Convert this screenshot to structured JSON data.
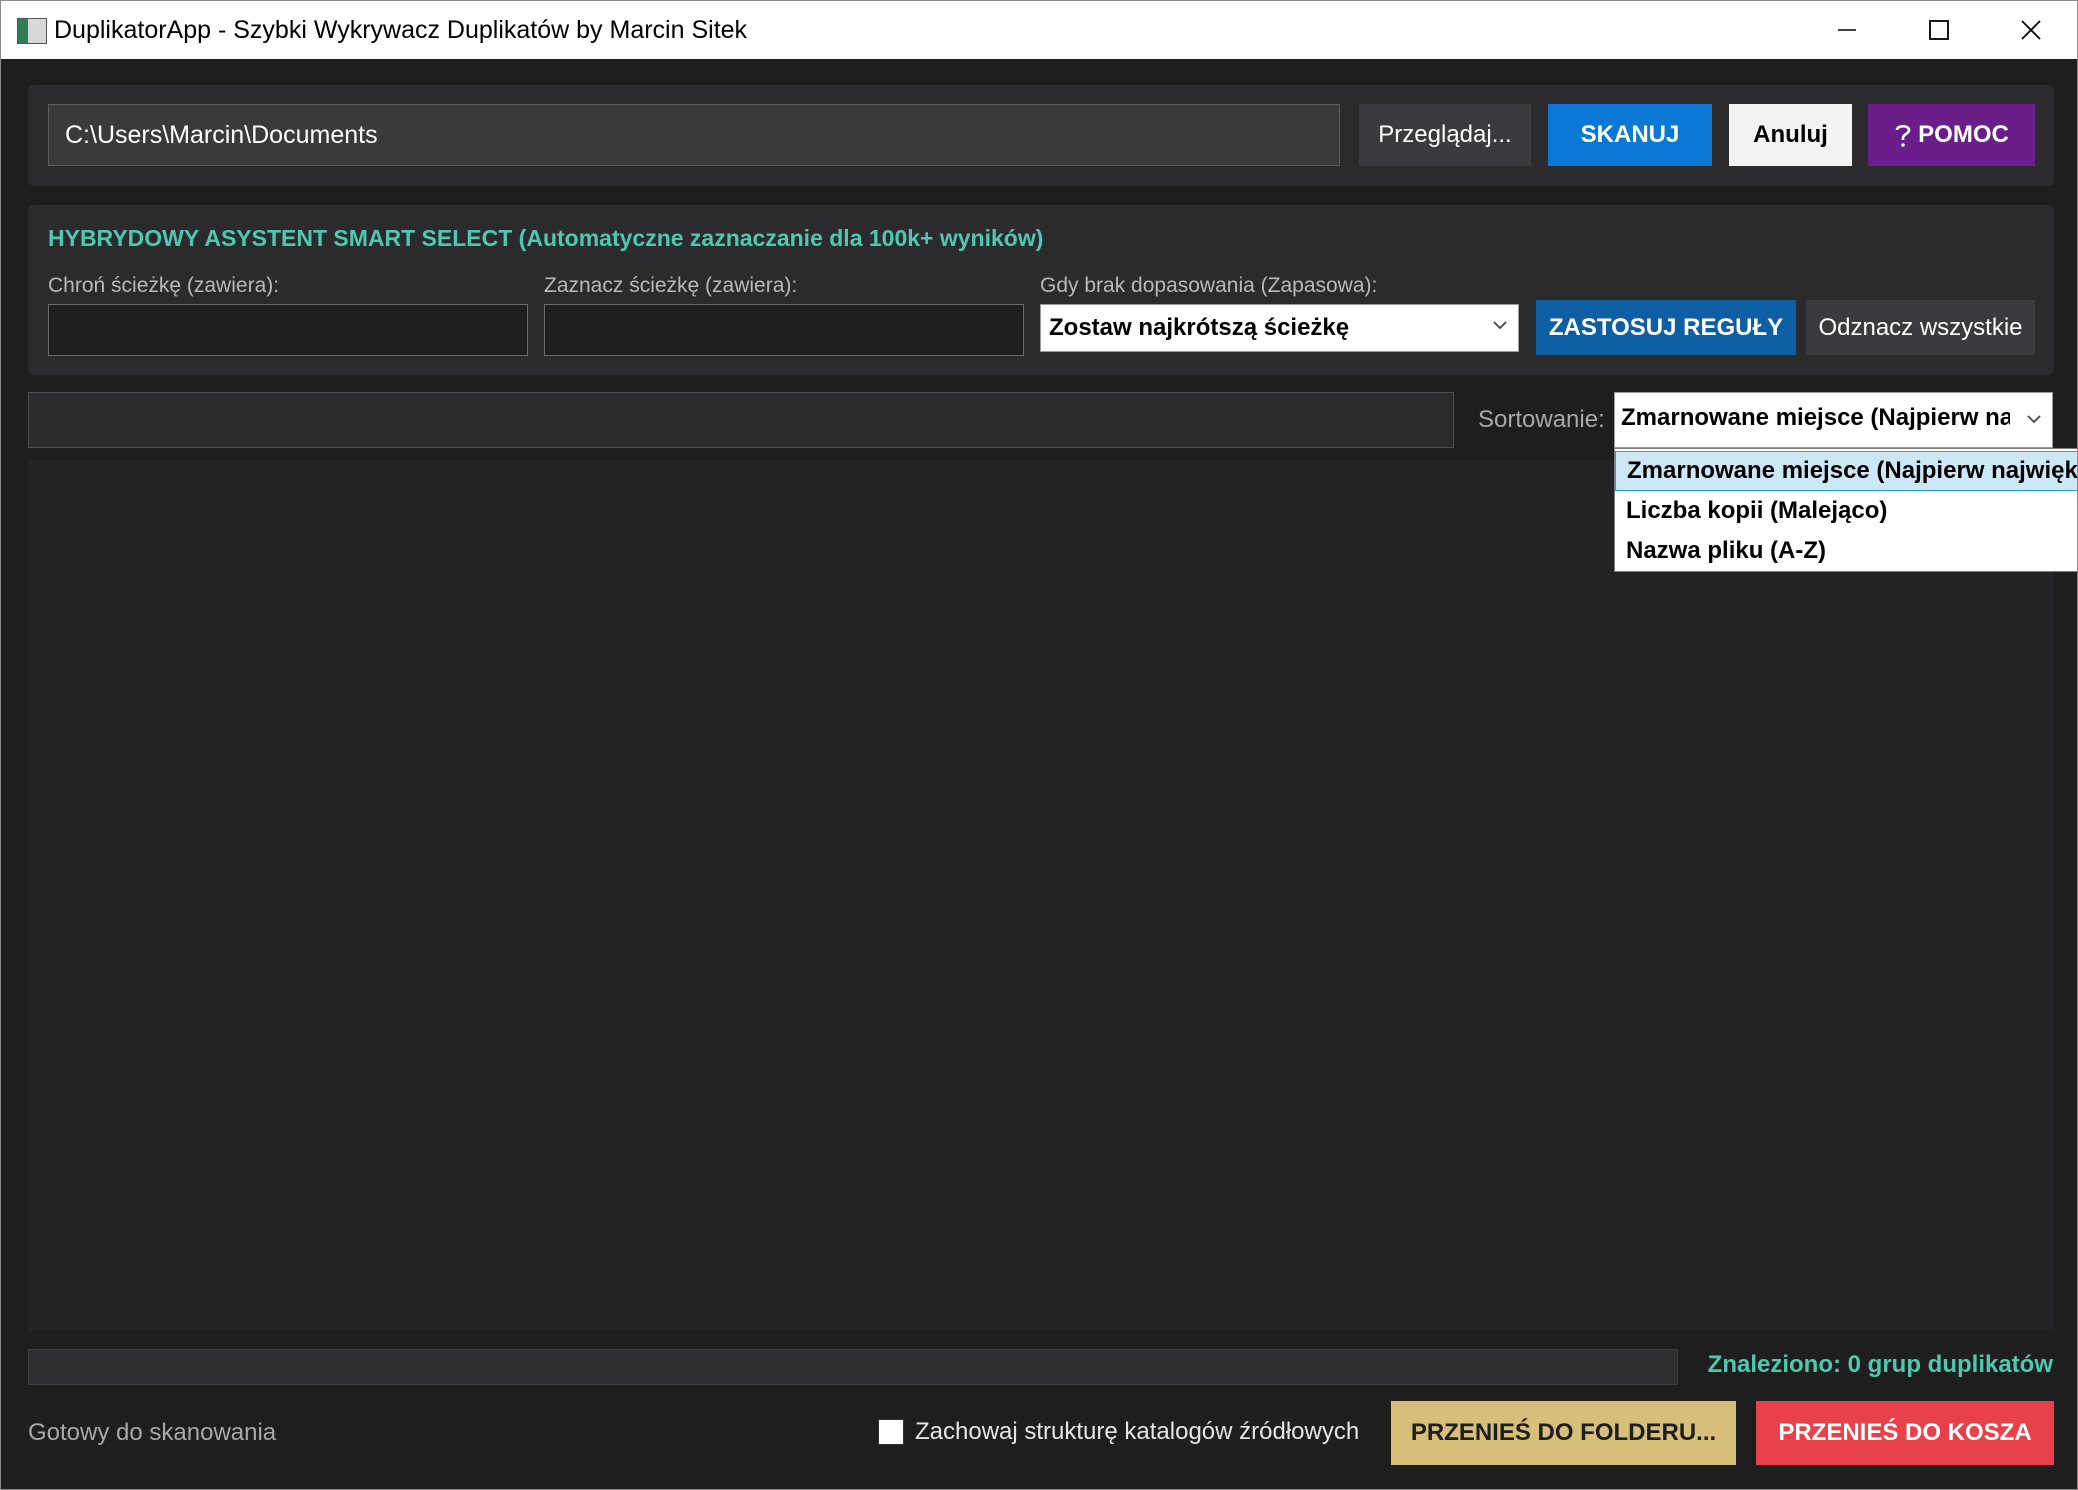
{
  "window": {
    "title": "DuplikatorApp - Szybki Wykrywacz Duplikatów by Marcin Sitek"
  },
  "toolbar": {
    "path_value": "C:\\Users\\Marcin\\Documents",
    "browse_label": "Przeglądaj...",
    "scan_label": "SKANUJ",
    "cancel_label": "Anuluj",
    "help_label": "POMOC",
    "help_icon": "question-icon"
  },
  "smart_select": {
    "title": "HYBRYDOWY ASYSTENT SMART SELECT (Automatyczne zaznaczanie dla 100k+ wyników)",
    "protect_label": "Chroń ścieżkę (zawiera):",
    "protect_value": "",
    "mark_label": "Zaznacz ścieżkę (zawiera):",
    "mark_value": "",
    "fallback_label": "Gdy brak dopasowania (Zapasowa):",
    "fallback_value": "Zostaw najkrótszą ścieżkę",
    "apply_label": "ZASTOSUJ REGUŁY",
    "deselect_label": "Odznacz wszystkie"
  },
  "filter": {
    "search_value": "",
    "sort_label": "Sortowanie:",
    "sort_value": "Zmarnowane miejsce (Najpierw największe)",
    "sort_options": [
      "Zmarnowane miejsce (Najpierw największe)",
      "Liczba kopii (Malejąco)",
      "Nazwa pliku (A-Z)"
    ]
  },
  "status": {
    "found_text": "Znaleziono: 0 grup duplikatów",
    "progress": 0,
    "ready_text": "Gotowy do skanowania",
    "keep_structure_label": "Zachowaj strukturę katalogów źródłowych",
    "keep_structure_checked": false,
    "move_folder_label": "PRZENIEŚ DO FOLDERU...",
    "move_trash_label": "PRZENIEŚ DO KOSZA"
  },
  "colors": {
    "accent_teal": "#4ec9b0",
    "scan_blue": "#0a78d4",
    "apply_blue": "#0e5ea3",
    "help_purple": "#6a1e8a",
    "folder_gold": "#d7bf7a",
    "trash_red": "#e8414a"
  }
}
